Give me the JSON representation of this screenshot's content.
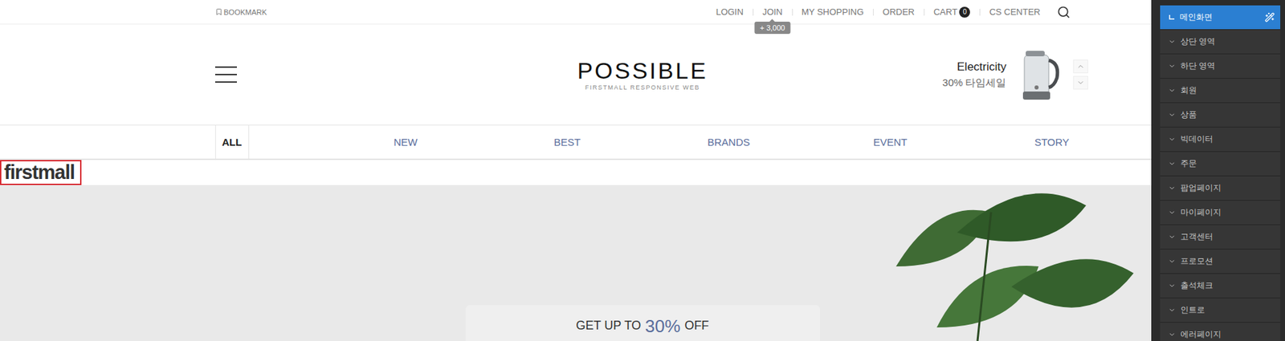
{
  "topbar": {
    "bookmark": "BOOKMARK",
    "links": [
      {
        "label": "LOGIN"
      },
      {
        "label": "JOIN",
        "tooltip": "+ 3,000"
      },
      {
        "label": "MY SHOPPING"
      },
      {
        "label": "ORDER"
      },
      {
        "label": "CART",
        "badge": "0"
      },
      {
        "label": "CS CENTER"
      }
    ]
  },
  "header": {
    "logo": "POSSIBLE",
    "tagline": "FIRSTMALL RESPONSIVE WEB",
    "promo": {
      "title": "Electricity",
      "subtitle": "30% 타임세일"
    }
  },
  "nav": [
    {
      "label": "ALL",
      "selected": true
    },
    {
      "label": "NEW",
      "selected": false
    },
    {
      "label": "BEST",
      "selected": false
    },
    {
      "label": "BRANDS",
      "selected": false
    },
    {
      "label": "EVENT",
      "selected": false
    },
    {
      "label": "STORY",
      "selected": false
    }
  ],
  "badge_logo": "firstmall",
  "hero": {
    "prefix": "GET UP TO",
    "highlight": "30%",
    "suffix": "OFF"
  },
  "sidebar": {
    "items": [
      {
        "label": "메인화면",
        "selected": true
      },
      {
        "label": "상단 영역",
        "selected": false
      },
      {
        "label": "하단 영역",
        "selected": false
      },
      {
        "label": "회원",
        "selected": false
      },
      {
        "label": "상품",
        "selected": false
      },
      {
        "label": "빅데이터",
        "selected": false
      },
      {
        "label": "주문",
        "selected": false
      },
      {
        "label": "팝업페이지",
        "selected": false
      },
      {
        "label": "마이페이지",
        "selected": false
      },
      {
        "label": "고객센터",
        "selected": false
      },
      {
        "label": "프로모션",
        "selected": false
      },
      {
        "label": "출석체크",
        "selected": false
      },
      {
        "label": "인트로",
        "selected": false
      },
      {
        "label": "에러페이지",
        "selected": false
      }
    ]
  }
}
